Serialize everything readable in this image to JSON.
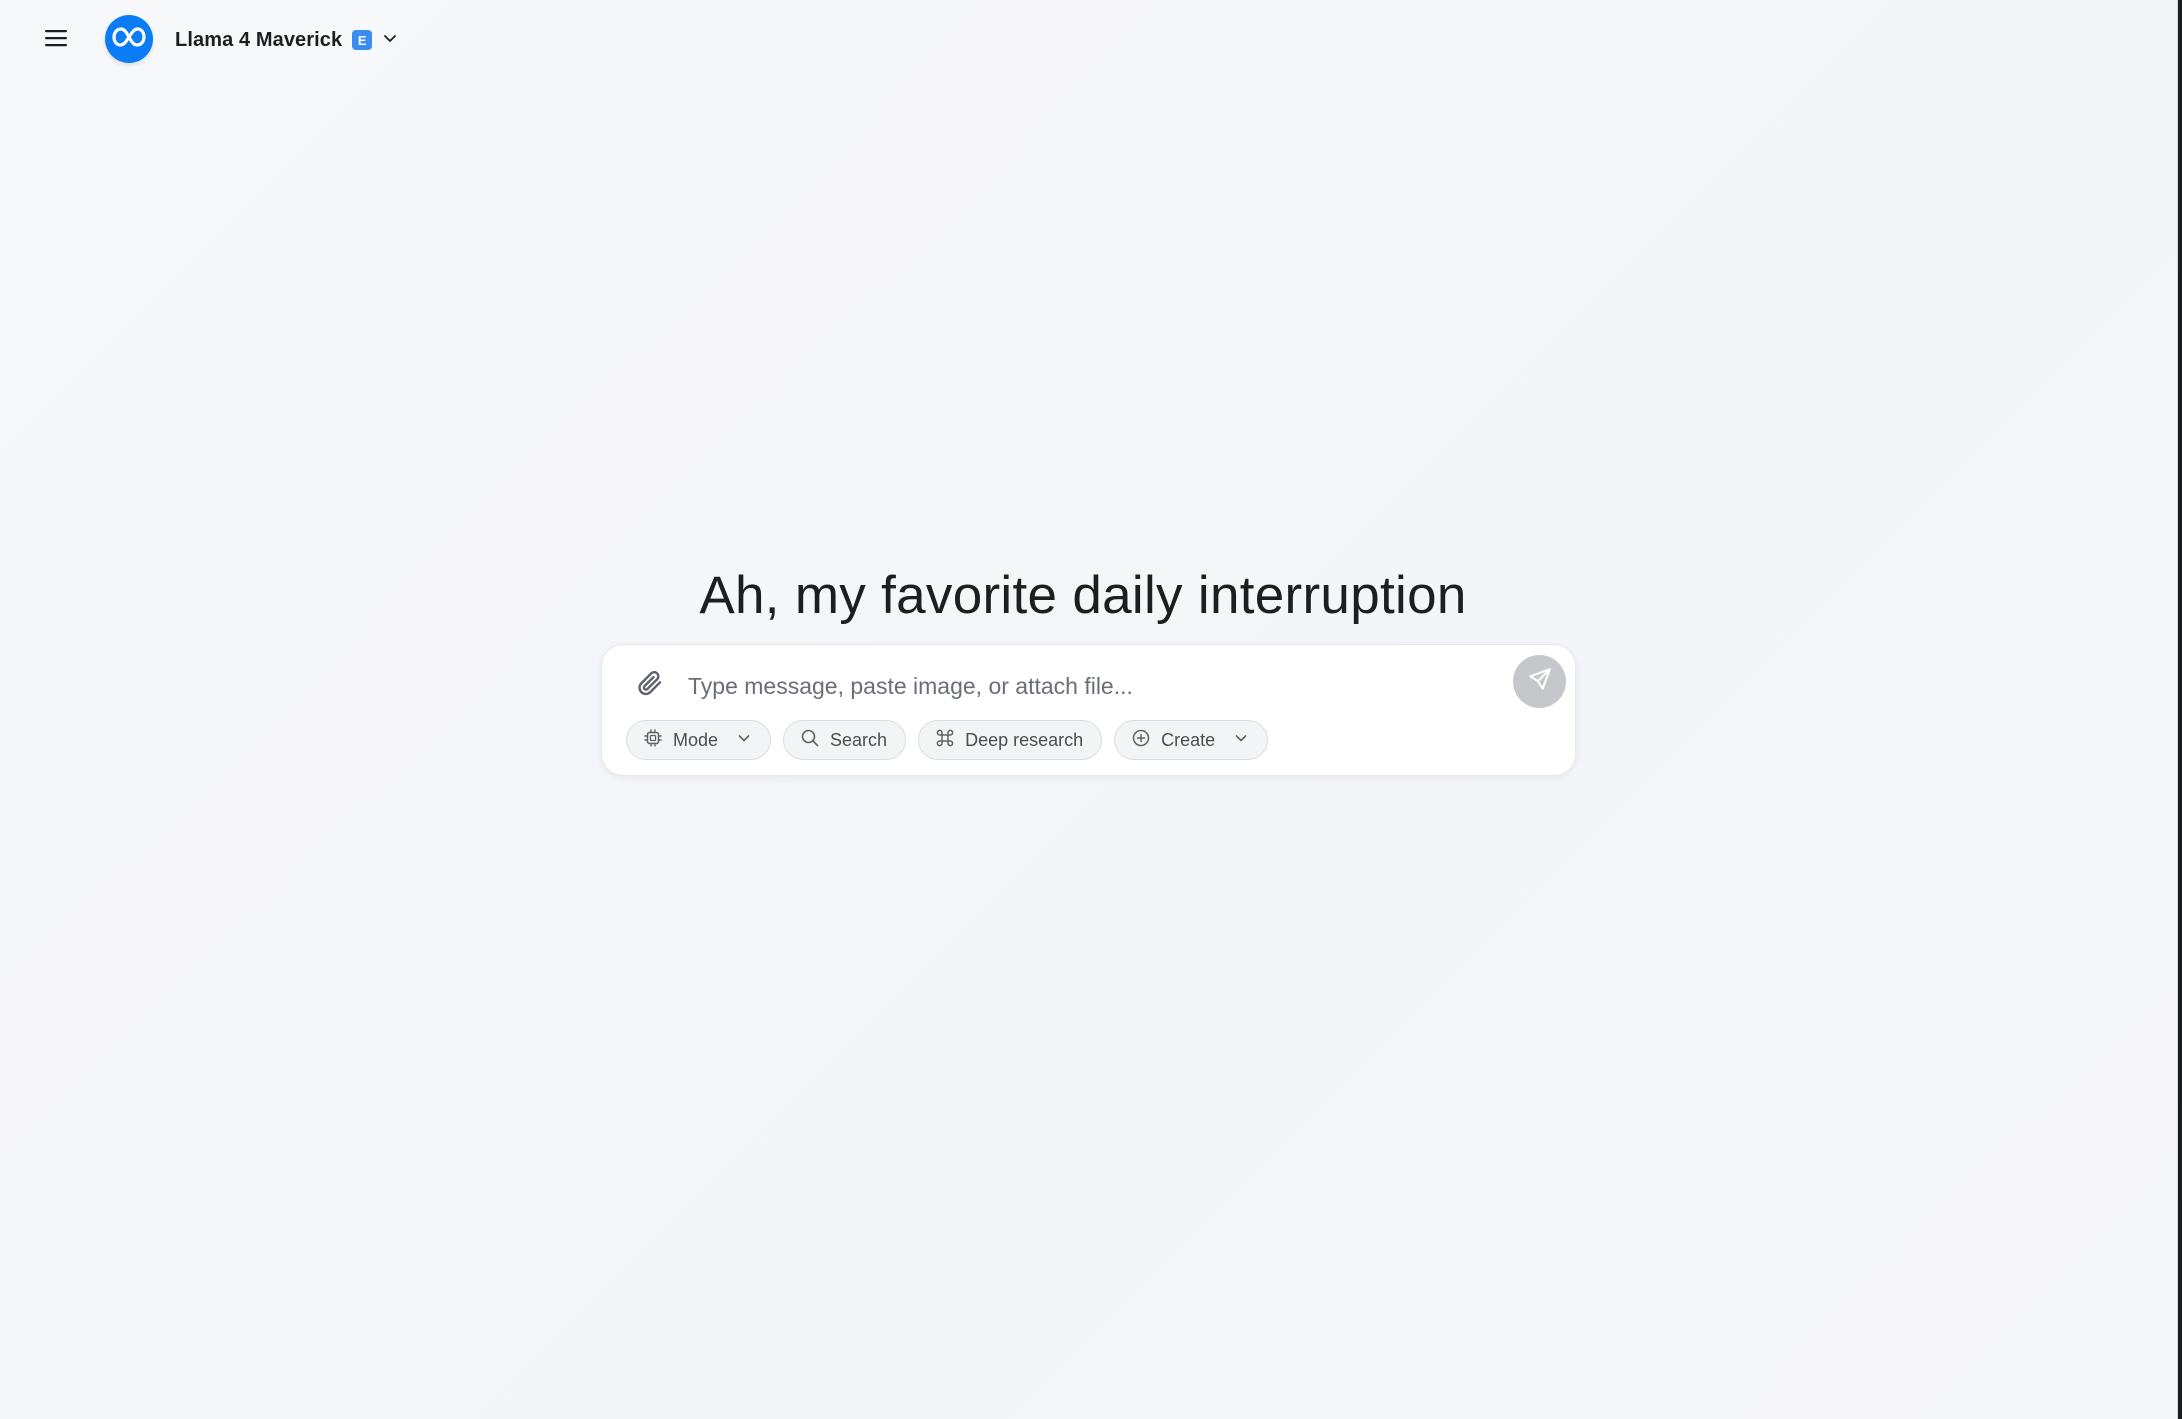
{
  "header": {
    "menu_icon": "hamburger-menu-icon",
    "logo_icon": "meta-infinity-logo-icon",
    "model_name": "Llama 4 Maverick",
    "model_badge": "E",
    "dropdown_icon": "chevron-down-icon"
  },
  "main": {
    "headline": "Ah, my favorite daily interruption"
  },
  "composer": {
    "attach_icon": "paperclip-icon",
    "placeholder": "Type message, paste image, or attach file...",
    "value": "",
    "send_icon": "send-arrow-icon",
    "chips": [
      {
        "label": "Mode",
        "icon": "cpu-chip-icon",
        "has_dropdown": true
      },
      {
        "label": "Search",
        "icon": "search-icon",
        "has_dropdown": false
      },
      {
        "label": "Deep research",
        "icon": "command-key-icon",
        "has_dropdown": false
      },
      {
        "label": "Create",
        "icon": "plus-circle-icon",
        "has_dropdown": true
      }
    ]
  },
  "colors": {
    "brand": "#0a7cf5",
    "badge": "#3a8cf0",
    "send_disabled": "#c5c7ca",
    "background": "#f5f6f9"
  }
}
